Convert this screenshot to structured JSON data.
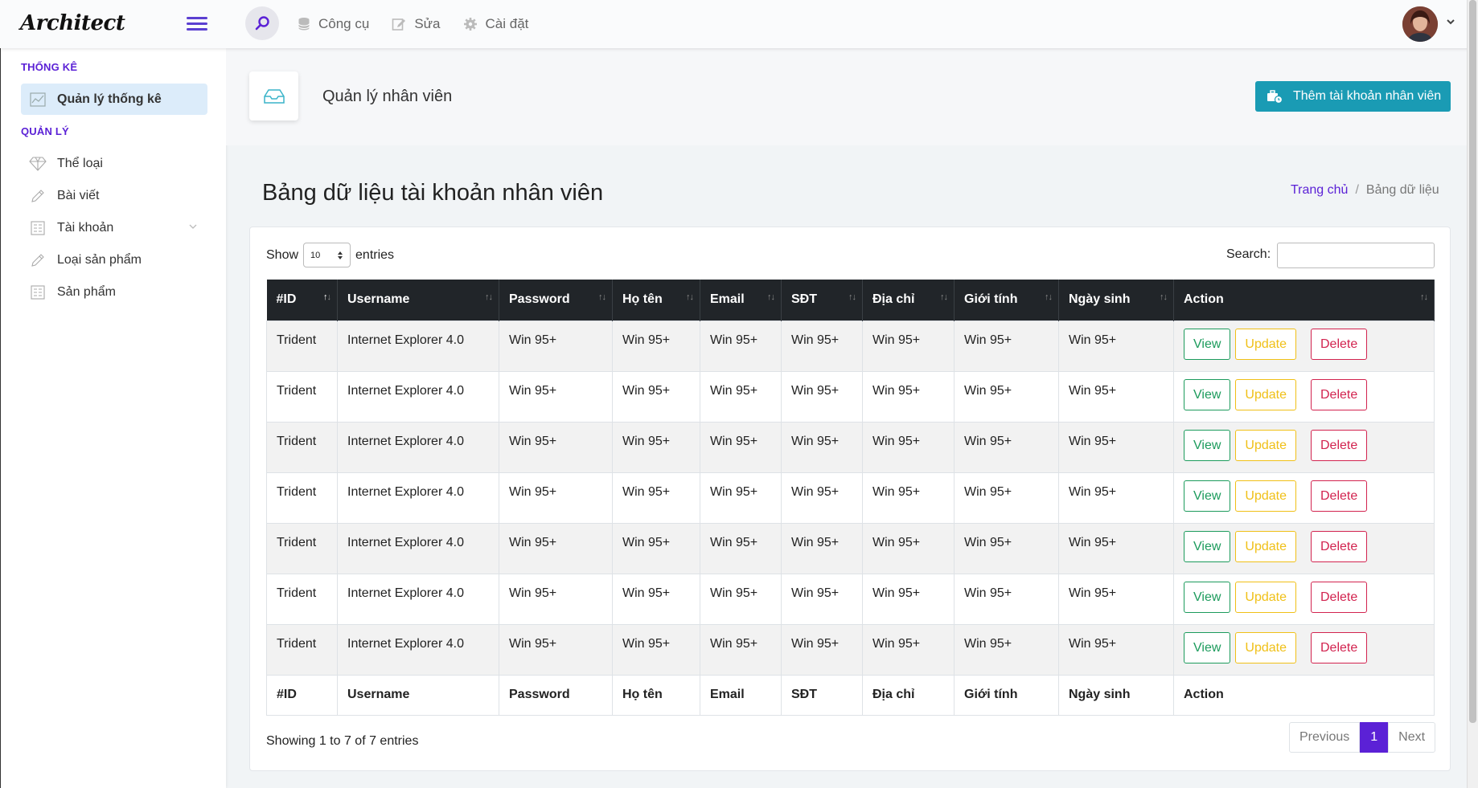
{
  "app": {
    "logo": "Architect"
  },
  "topnav": [
    {
      "label": "Công cụ",
      "icon": "database-icon"
    },
    {
      "label": "Sửa",
      "icon": "edit-icon"
    },
    {
      "label": "Cài đặt",
      "icon": "gear-icon"
    }
  ],
  "sidebar": {
    "section1": "THỐNG KÊ",
    "item_stats": "Quản lý thống kê",
    "section2": "QUẢN LÝ",
    "items": [
      {
        "label": "Thể loại",
        "icon": "diamond-icon"
      },
      {
        "label": "Bài viết",
        "icon": "pencil-icon"
      },
      {
        "label": "Tài khoản",
        "icon": "building-icon"
      },
      {
        "label": "Loại sản phẩm",
        "icon": "pencil-icon"
      },
      {
        "label": "Sản phẩm",
        "icon": "building-icon"
      }
    ]
  },
  "page": {
    "title": "Quản lý nhân viên",
    "add_button": "Thêm tài khoản nhân viên",
    "heading": "Bảng dữ liệu tài khoản nhân viên",
    "breadcrumb_home": "Trang chủ",
    "breadcrumb_sep": "/",
    "breadcrumb_current": "Bảng dữ liệu"
  },
  "table_controls": {
    "show": "Show",
    "entries_value": "10",
    "entries": "entries",
    "search_label": "Search:",
    "search_value": ""
  },
  "table": {
    "columns": [
      "#ID",
      "Username",
      "Password",
      "Họ tên",
      "Email",
      "SĐT",
      "Địa chỉ",
      "Giới tính",
      "Ngày sinh",
      "Action"
    ],
    "rows": [
      [
        "Trident",
        "Internet Explorer 4.0",
        "Win 95+",
        "Win 95+",
        "Win 95+",
        "Win 95+",
        "Win 95+",
        "Win 95+",
        "Win 95+"
      ],
      [
        "Trident",
        "Internet Explorer 4.0",
        "Win 95+",
        "Win 95+",
        "Win 95+",
        "Win 95+",
        "Win 95+",
        "Win 95+",
        "Win 95+"
      ],
      [
        "Trident",
        "Internet Explorer 4.0",
        "Win 95+",
        "Win 95+",
        "Win 95+",
        "Win 95+",
        "Win 95+",
        "Win 95+",
        "Win 95+"
      ],
      [
        "Trident",
        "Internet Explorer 4.0",
        "Win 95+",
        "Win 95+",
        "Win 95+",
        "Win 95+",
        "Win 95+",
        "Win 95+",
        "Win 95+"
      ],
      [
        "Trident",
        "Internet Explorer 4.0",
        "Win 95+",
        "Win 95+",
        "Win 95+",
        "Win 95+",
        "Win 95+",
        "Win 95+",
        "Win 95+"
      ],
      [
        "Trident",
        "Internet Explorer 4.0",
        "Win 95+",
        "Win 95+",
        "Win 95+",
        "Win 95+",
        "Win 95+",
        "Win 95+",
        "Win 95+"
      ],
      [
        "Trident",
        "Internet Explorer 4.0",
        "Win 95+",
        "Win 95+",
        "Win 95+",
        "Win 95+",
        "Win 95+",
        "Win 95+",
        "Win 95+"
      ]
    ],
    "actions": {
      "view": "View",
      "update": "Update",
      "delete": "Delete"
    }
  },
  "footer": {
    "info": "Showing 1 to 7 of 7 entries",
    "previous": "Previous",
    "page": "1",
    "next": "Next"
  },
  "colors": {
    "accent": "#5b21d6",
    "primary_button": "#1a9bb4",
    "header_dark": "#212529"
  }
}
